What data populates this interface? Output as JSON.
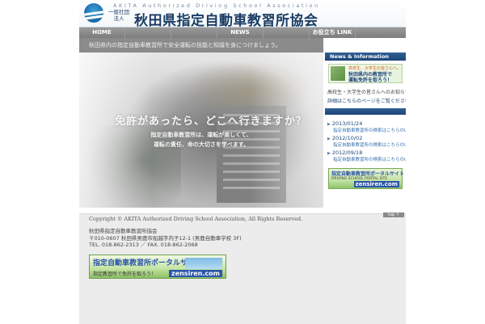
{
  "header": {
    "org_sub": "AKITA Authorized Driving School Association",
    "corp_type": "一般社団法人",
    "title": "秋田県指定自動車教習所協会"
  },
  "nav": {
    "items": [
      {
        "label": "HOME"
      },
      {
        "label": ""
      },
      {
        "label": ""
      },
      {
        "label": "NEWS"
      },
      {
        "label": ""
      },
      {
        "label": "お役立ち LINK"
      },
      {
        "label": ""
      }
    ]
  },
  "tagline": "秋田県内の指定自動車教習所で安全運転の技能と知識を身につけましょう。",
  "hero": {
    "heading": "免許があったら、どこへ行きますか？",
    "body_line1": "指定自動車教習所は、運転が楽しくて、",
    "body_line2": "運転の責任、命の大切さを学べます。"
  },
  "sidebar": {
    "news_header": "News & Information",
    "student_banner": {
      "line1": "高校生、大学生の皆さんへ。",
      "line2": "秋田県内の教習所で",
      "line3": "運転免許を取ろう！"
    },
    "text1": "高校生・大学生の皆さんへのお知らせ掲載中です。",
    "link1": "詳細はこちらのページをご覧ください。",
    "news": [
      {
        "date": "2013/01/24",
        "text": "指定自動車教習所の検索はこちらのURLから"
      },
      {
        "date": "2012/10/02",
        "text": "指定自動車教習所の検索はこちらのURLから"
      },
      {
        "date": "2012/09/18",
        "text": "指定自動車教習所の検索はこちらのURLから"
      }
    ],
    "zensiren_banner": {
      "title": "指定自動車教習所ポータルサイト",
      "sub": "DRIVING SCHOOL PORTAL SITE",
      "brand": "zensiren.com"
    }
  },
  "footer": {
    "top_button": "top ↑",
    "copyright": "Copyright © AKITA Authorized Driving School Association, All Rights Reserved.",
    "org_name": "秋田県指定自動車教習所協会",
    "address": "〒010-0607 秋田県男鹿市船越字内子12-1 (男鹿自動車学校 3F)",
    "tel": "TEL. 018-862-2313 ／ FAX. 018-862-2068",
    "banner": {
      "title": "指定自動車教習所ポータルサイト",
      "sub": "指定教習所で免許を取ろう！",
      "brand": "zensiren.com"
    }
  },
  "colors": {
    "brand_navy": "#1c4577",
    "nav_gray": "#8a8a8a",
    "link_blue": "#3b72b0"
  }
}
